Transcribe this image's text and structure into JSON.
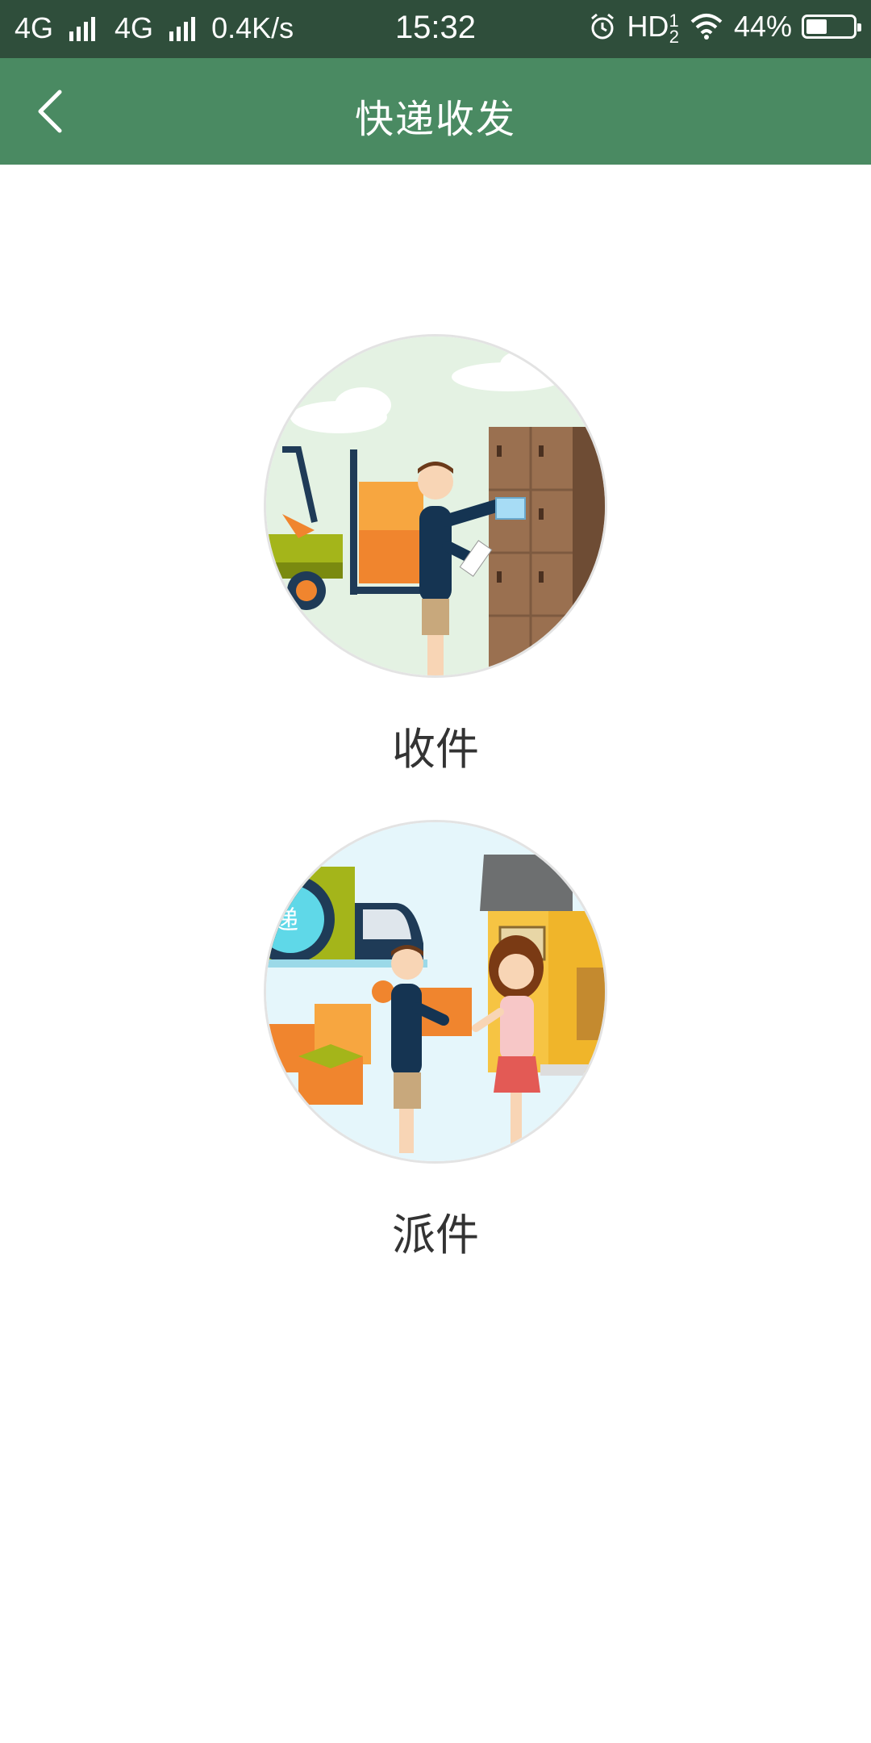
{
  "status_bar": {
    "network1": "4G",
    "network2": "4G",
    "speed": "0.4K/s",
    "time": "15:32",
    "hd": "HD",
    "battery_percent": "44%",
    "battery_level": 0.44
  },
  "header": {
    "title": "快递收发",
    "back_icon": "chevron-left-icon"
  },
  "options": [
    {
      "label": "收件"
    },
    {
      "label": "派件"
    }
  ],
  "colors": {
    "status_bar": "#2f4e3b",
    "app_bar": "#4a8a62",
    "label_text": "#333333"
  }
}
